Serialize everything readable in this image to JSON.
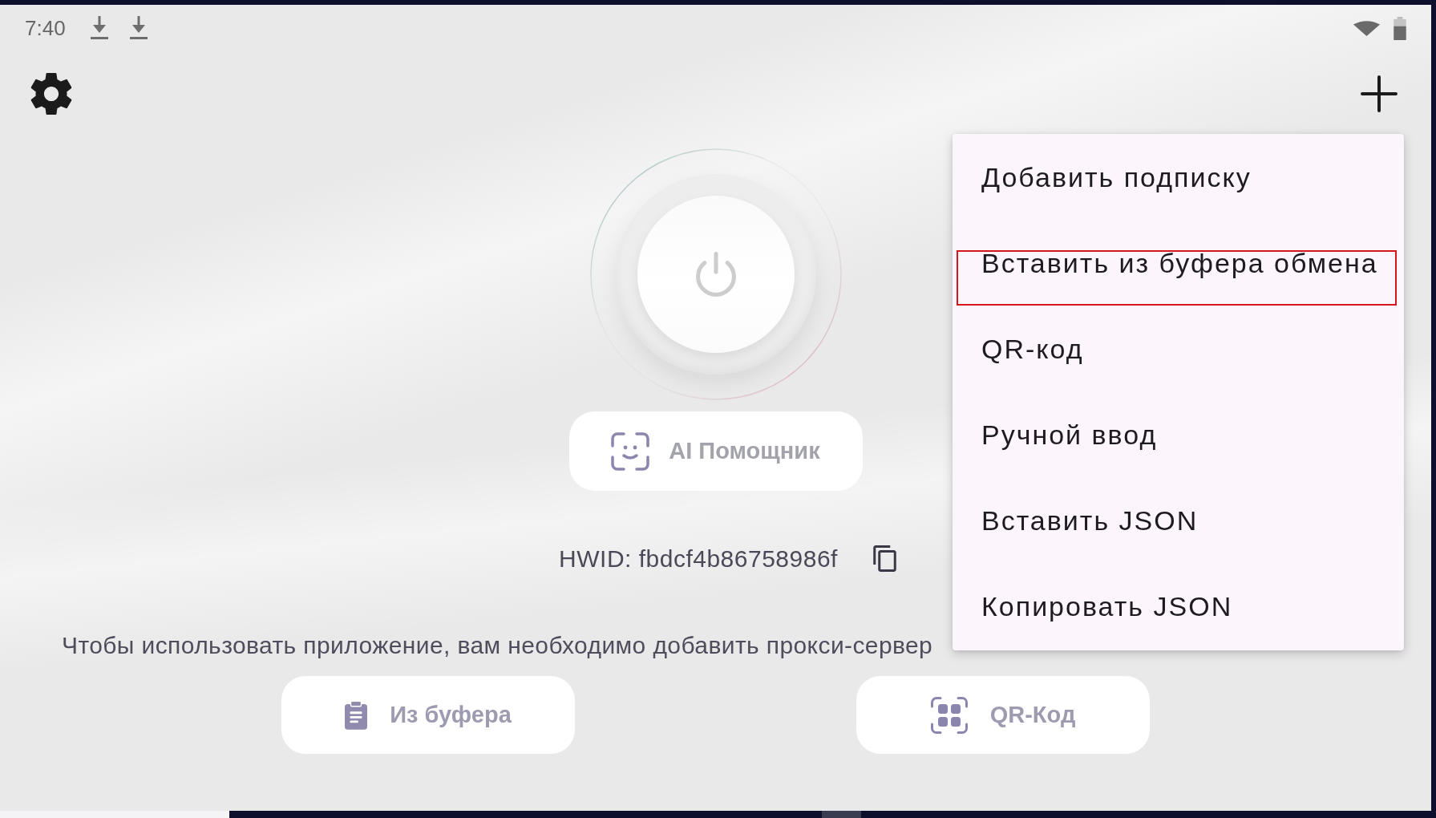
{
  "status_bar": {
    "time": "7:40"
  },
  "ai_button": {
    "label": "AI Помощник"
  },
  "hwid": {
    "text": "HWID: fbdcf4b86758986f"
  },
  "hint": "Чтобы использовать приложение, вам необходимо добавить прокси-сервер",
  "actions": [
    {
      "kind": "clipboard",
      "label": "Из буфера"
    },
    {
      "kind": "qr",
      "label": "QR-Код"
    }
  ],
  "menu": {
    "items": [
      {
        "label": "Добавить подписку",
        "highlighted": false
      },
      {
        "label": "Вставить из буфера обмена",
        "highlighted": true
      },
      {
        "label": "QR-код",
        "highlighted": false
      },
      {
        "label": "Ручной ввод",
        "highlighted": false
      },
      {
        "label": "Вставить JSON",
        "highlighted": false
      },
      {
        "label": "Копировать JSON",
        "highlighted": false
      }
    ]
  }
}
